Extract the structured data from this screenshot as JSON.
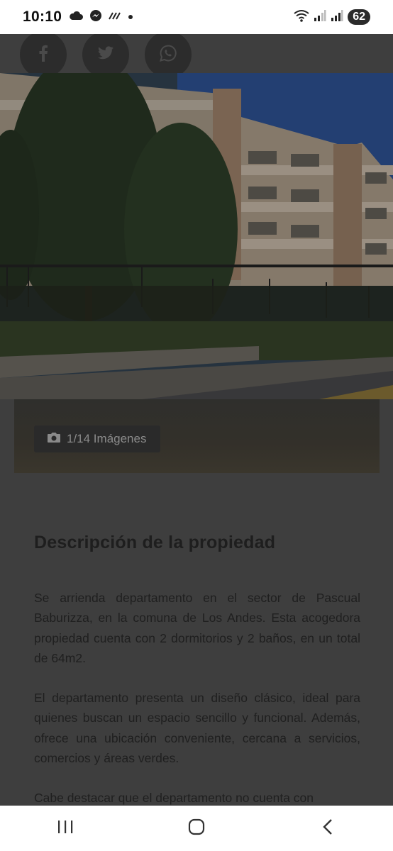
{
  "status_bar": {
    "time": "10:10",
    "battery": "62",
    "left_icons": [
      "cloud-icon",
      "messenger-icon",
      "data-saver-icon",
      "dot-icon"
    ],
    "right_icons": [
      "wifi-icon",
      "signal-icon",
      "signal-icon"
    ]
  },
  "share": {
    "icons": [
      "facebook-icon",
      "twitter-icon",
      "whatsapp-icon"
    ]
  },
  "gallery": {
    "counter": "1/14 Imágenes"
  },
  "description": {
    "title": "Descripción de la propiedad",
    "paragraphs": [
      "Se arrienda departamento en el sector de Pascual Baburizza, en la comuna de Los Andes. Esta acogedora propiedad cuenta con 2 dormitorios y 2 baños, en un total de 64m2.",
      "El departamento presenta un diseño clásico, ideal para quienes buscan un espacio sencillo y funcional. Además, ofrece una ubicación conveniente, cercana a servicios, comercios y áreas verdes.",
      "Cabe destacar que el departamento no cuenta con"
    ]
  },
  "nav_bar": {
    "icons": [
      "recent-apps-icon",
      "home-icon",
      "back-icon"
    ]
  }
}
